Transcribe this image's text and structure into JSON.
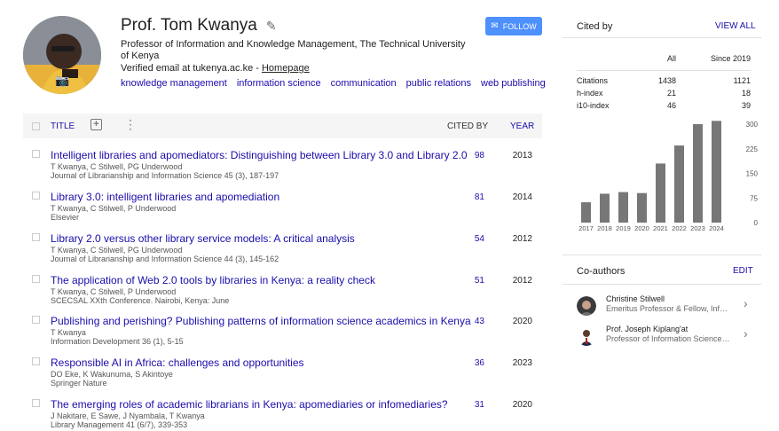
{
  "profile": {
    "name": "Prof. Tom Kwanya",
    "affiliation": "Professor of Information and Knowledge Management, The Technical University of Kenya",
    "email_text": "Verified email at tukenya.ac.ke - ",
    "homepage": "Homepage",
    "interests": [
      "knowledge management",
      "information science",
      "communication",
      "public relations",
      "web publishing"
    ],
    "follow_label": "FOLLOW"
  },
  "table": {
    "title_header": "TITLE",
    "cited_header": "CITED BY",
    "year_header": "YEAR",
    "rows": [
      {
        "title": "Intelligent libraries and apomediators: Distinguishing between Library 3.0 and Library 2.0",
        "authors": "T Kwanya, C Stilwell, PG Underwood",
        "venue": "Journal of Librarianship and Information Science 45 (3), 187-197",
        "cites": "98",
        "year": "2013"
      },
      {
        "title": "Library 3.0: intelligent libraries and apomediation",
        "authors": "T Kwanya, C Stilwell, P Underwood",
        "venue": "Elsevier",
        "cites": "81",
        "year": "2014"
      },
      {
        "title": "Library 2.0 versus other library service models: A critical analysis",
        "authors": "T Kwanya, C Stilwell, PG Underwood",
        "venue": "Journal of Librarianship and Information Science 44 (3), 145-162",
        "cites": "54",
        "year": "2012"
      },
      {
        "title": "The application of Web 2.0 tools by libraries in Kenya: a reality check",
        "authors": "T Kwanya, C Stilwell, P Underwood",
        "venue": "SCECSAL XXth Conference. Nairobi, Kenya: June",
        "cites": "51",
        "year": "2012"
      },
      {
        "title": "Publishing and perishing? Publishing patterns of information science academics in Kenya",
        "authors": "T Kwanya",
        "venue": "Information Development 36 (1), 5-15",
        "cites": "43",
        "year": "2020"
      },
      {
        "title": "Responsible AI in Africa: challenges and opportunities",
        "authors": "DO Eke, K Wakunuma, S Akintoye",
        "venue": "Springer Nature",
        "cites": "36",
        "year": "2023"
      },
      {
        "title": "The emerging roles of academic librarians in Kenya: apomediaries or infomediaries?",
        "authors": "J Nakitare, E Sawe, J Nyambala, T Kwanya",
        "venue": "Library Management 41 (6/7), 339-353",
        "cites": "31",
        "year": "2020"
      }
    ]
  },
  "cited_by": {
    "heading": "Cited by",
    "view_all": "VIEW ALL",
    "col_all": "All",
    "col_since": "Since 2019",
    "stats": [
      {
        "label": "Citations",
        "all": "1438",
        "since": "1121"
      },
      {
        "label": "h-index",
        "all": "21",
        "since": "18"
      },
      {
        "label": "i10-index",
        "all": "46",
        "since": "39"
      }
    ]
  },
  "chart_data": {
    "type": "bar",
    "categories": [
      "2017",
      "2018",
      "2019",
      "2020",
      "2021",
      "2022",
      "2023",
      "2024"
    ],
    "values": [
      62,
      88,
      93,
      90,
      180,
      235,
      300,
      310
    ],
    "ylim": [
      0,
      300
    ],
    "yticks": [
      0,
      75,
      150,
      225,
      300
    ],
    "bar_color": "#777777"
  },
  "coauthors": {
    "heading": "Co-authors",
    "edit": "EDIT",
    "items": [
      {
        "name": "Christine Stilwell",
        "desc": "Emeritus Professor & Fellow, Information Studies, University of KwaZulu-Natal"
      },
      {
        "name": "Prof. Joseph Kiplang'at",
        "desc": "Professor of Information Science, Technical University of Kenya"
      }
    ]
  },
  "colors": {
    "link": "#1a0dab",
    "follow_bg": "#4d90fe"
  }
}
